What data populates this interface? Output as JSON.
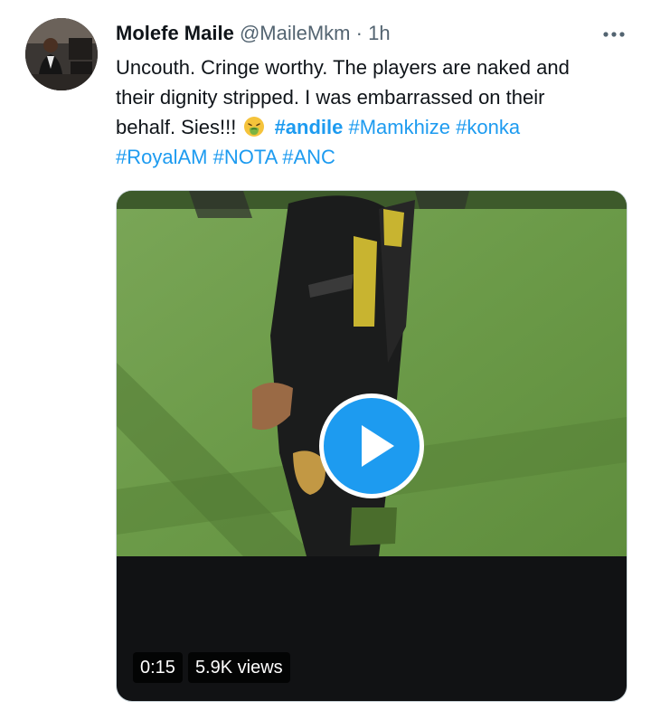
{
  "tweet": {
    "author": {
      "display_name": "Molefe Maile",
      "handle": "@MaileMkm",
      "separator": "·",
      "time": "1h"
    },
    "more_icon": "more-horizontal-icon",
    "text": {
      "line1": "Uncouth. Cringe worthy. The players are naked and",
      "line2": "their dignity stripped. I was embarrassed on their",
      "line3": "behalf. Sies!!!",
      "emoji": "nauseated-face-emoji",
      "hashtags": [
        "#andile",
        "#Mamkhize",
        "#konka",
        "#RoyalAM",
        "#NOTA",
        "#ANC"
      ]
    },
    "video": {
      "duration": "0:15",
      "views": "5.9K views",
      "play_icon": "play-icon"
    },
    "colors": {
      "accent": "#1d9bf0",
      "text": "#0f1419",
      "secondary": "#536471",
      "grass": "#6f9e4a",
      "video_bg": "#111214"
    }
  }
}
